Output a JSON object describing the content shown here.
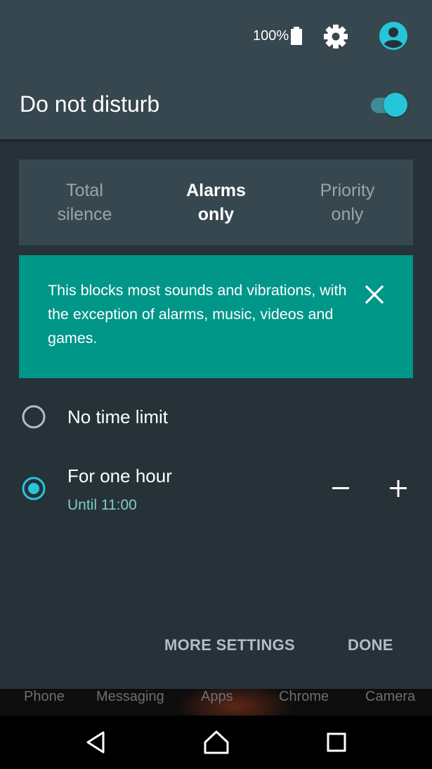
{
  "status_bar": {
    "battery_percent": "100%",
    "icons": [
      "battery-icon",
      "gear-icon",
      "account-avatar-icon"
    ]
  },
  "header": {
    "title": "Do not disturb",
    "toggle_on": true
  },
  "mode_tabs": [
    {
      "label": "Total\nsilence",
      "selected": false
    },
    {
      "label": "Alarms\nonly",
      "selected": true
    },
    {
      "label": "Priority\nonly",
      "selected": false
    }
  ],
  "info_card": {
    "text": "This blocks most sounds and vibrations, with the exception of alarms, music, videos and games."
  },
  "options": [
    {
      "label": "No time limit",
      "selected": false
    },
    {
      "label": "For one hour",
      "sublabel": "Until 11:00",
      "selected": true
    }
  ],
  "actions": {
    "more_settings": "MORE SETTINGS",
    "done": "DONE"
  },
  "dock": {
    "items": [
      "Phone",
      "Messaging",
      "Apps",
      "Chrome",
      "Camera"
    ]
  },
  "colors": {
    "accent": "#26c6da",
    "card": "#009688",
    "header_bg": "#37474f",
    "panel_bg": "#263238"
  }
}
